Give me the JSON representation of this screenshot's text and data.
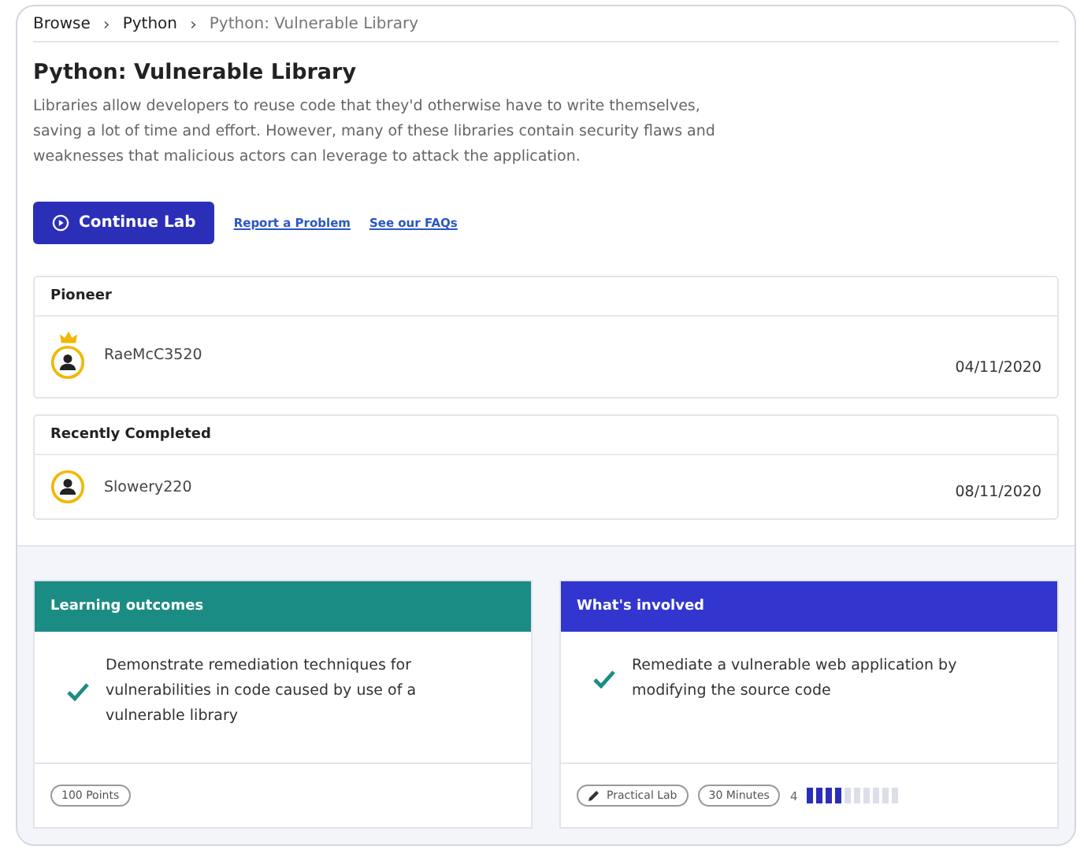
{
  "breadcrumb": [
    {
      "label": "Browse",
      "current": false
    },
    {
      "label": "Python",
      "current": false
    },
    {
      "label": "Python: Vulnerable Library",
      "current": true
    }
  ],
  "separator": "›",
  "title": "Python: Vulnerable Library",
  "description": "Libraries allow developers to reuse code that they'd otherwise have to write themselves, saving a lot of time and effort. However, many of these libraries contain security flaws and weaknesses that malicious actors can leverage to attack the application.",
  "actions": {
    "primary": "Continue Lab",
    "links": [
      "Report a Problem",
      "See our FAQs"
    ]
  },
  "panels": [
    {
      "heading": "Pioneer",
      "user": "RaeMcC3520",
      "date": "04/11/2020",
      "crowned": true
    },
    {
      "heading": "Recently Completed",
      "user": "Slowery220",
      "date": "08/11/2020",
      "crowned": false
    }
  ],
  "cards": [
    {
      "heading": "Learning outcomes",
      "color": "#1b8c84",
      "items": [
        "Demonstrate remediation techniques for vulnerabilities in code caused by use of a vulnerable library"
      ],
      "tags": [
        {
          "kind": "plain",
          "label": "100 Points"
        }
      ]
    },
    {
      "heading": "What's involved",
      "color": "#3236cf",
      "items": [
        "Remediate a vulnerable web application by modifying the source code"
      ],
      "tags": [
        {
          "kind": "pencil",
          "label": "Practical Lab"
        },
        {
          "kind": "plain",
          "label": "30 Minutes"
        }
      ],
      "difficulty": {
        "reading": "4",
        "level": 0.4
      }
    }
  ]
}
